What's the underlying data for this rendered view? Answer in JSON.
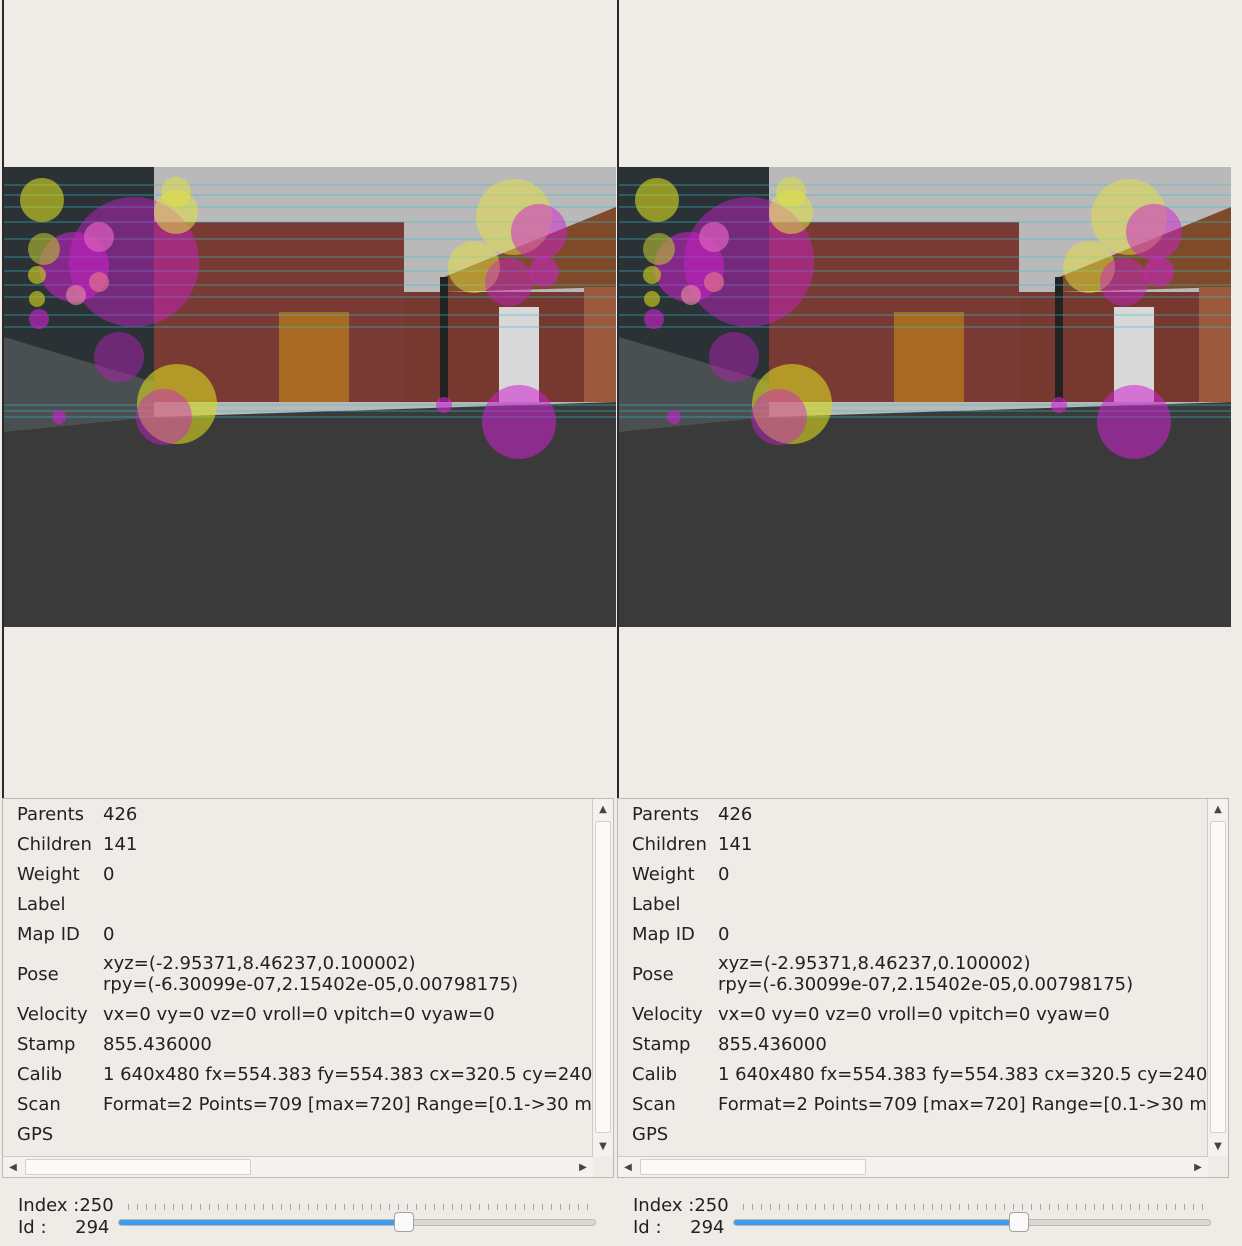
{
  "panes": [
    {
      "side": "left",
      "info": [
        {
          "key": "Parents",
          "value": "426"
        },
        {
          "key": "Children",
          "value": "141"
        },
        {
          "key": "Weight",
          "value": "0"
        },
        {
          "key": "Label",
          "value": ""
        },
        {
          "key": "Map ID",
          "value": "0"
        },
        {
          "key": "Pose",
          "value": "xyz=(-2.95371,8.46237,0.100002)",
          "value2": "rpy=(-6.30099e-07,2.15402e-05,0.00798175)"
        },
        {
          "key": "Velocity",
          "value": "vx=0 vy=0 vz=0 vroll=0 vpitch=0 vyaw=0"
        },
        {
          "key": "Stamp",
          "value": "855.436000"
        },
        {
          "key": "Calib",
          "value": "1 640x480 fx=554.383 fy=554.383 cx=320.5 cy=240"
        },
        {
          "key": "Scan",
          "value": "Format=2 Points=709 [max=720] Range=[0.1->30 m"
        },
        {
          "key": "GPS",
          "value": ""
        }
      ],
      "index_label": "Index :",
      "index_value": "250",
      "id_label": "Id :",
      "id_value": "294",
      "slider_fraction": 0.6
    },
    {
      "side": "right",
      "info": [
        {
          "key": "Parents",
          "value": "426"
        },
        {
          "key": "Children",
          "value": "141"
        },
        {
          "key": "Weight",
          "value": "0"
        },
        {
          "key": "Label",
          "value": ""
        },
        {
          "key": "Map ID",
          "value": "0"
        },
        {
          "key": "Pose",
          "value": "xyz=(-2.95371,8.46237,0.100002)",
          "value2": "rpy=(-6.30099e-07,2.15402e-05,0.00798175)"
        },
        {
          "key": "Velocity",
          "value": "vx=0 vy=0 vz=0 vroll=0 vpitch=0 vyaw=0"
        },
        {
          "key": "Stamp",
          "value": "855.436000"
        },
        {
          "key": "Calib",
          "value": "1 640x480 fx=554.383 fy=554.383 cx=320.5 cy=240"
        },
        {
          "key": "Scan",
          "value": "Format=2 Points=709 [max=720] Range=[0.1->30 m"
        },
        {
          "key": "GPS",
          "value": ""
        }
      ],
      "index_label": "Index :",
      "index_value": "250",
      "id_label": "Id :",
      "id_value": "294",
      "slider_fraction": 0.6
    }
  ],
  "icons": {
    "scroll_up": "▲",
    "scroll_down": "▼",
    "scroll_left": "◀",
    "scroll_right": "▶"
  },
  "colors": {
    "background": "#efebe7",
    "slider_fill": "#3b9cf0",
    "feature_magenta": "#d020d0",
    "feature_yellow": "#d8d820",
    "match_line": "#35c0c8",
    "sky": "#b9b9b9",
    "ground": "#3a3a3a",
    "brick": "#7a3a34"
  }
}
